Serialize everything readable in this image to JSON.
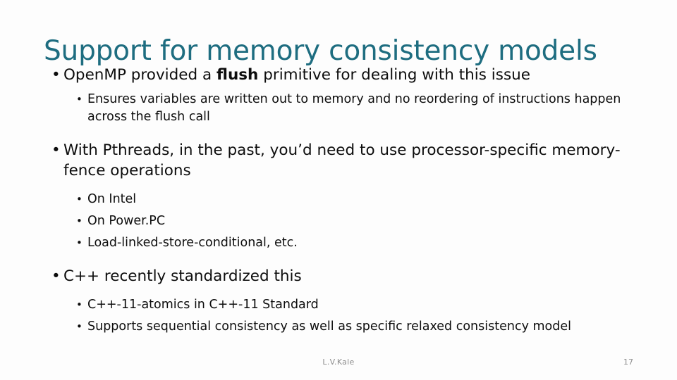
{
  "slide": {
    "title": "Support for memory consistency models",
    "title_color": "#1e6d80",
    "background_color": "#fdfdfd",
    "body_color": "#0d0d0d",
    "bullet_glyph_l1": "•",
    "bullet_glyph_l2": "•",
    "content": [
      {
        "level": 1,
        "text_before": "OpenMP provided a ",
        "text_bold": "flush",
        "text_after": " primitive for dealing with this issue"
      },
      {
        "level": 2,
        "text": "Ensures variables are written out to memory and no reordering of instructions happen across the flush call"
      },
      {
        "level": 1,
        "text": "With Pthreads, in the past, you’d need to use processor-specific memory-fence operations"
      },
      {
        "level": 2,
        "text": "On Intel"
      },
      {
        "level": 2,
        "text": "On Power.PC"
      },
      {
        "level": 2,
        "text": "Load-linked-store-conditional, etc."
      },
      {
        "level": 1,
        "text": "C++ recently standardized this"
      },
      {
        "level": 2,
        "text": "C++-11-atomics in C++-11 Standard"
      },
      {
        "level": 2,
        "text": "Supports sequential consistency as well as specific relaxed consistency model"
      }
    ]
  },
  "footer": {
    "author": "L.V.Kale",
    "page_number": "17",
    "color": "#8c8c8c"
  }
}
